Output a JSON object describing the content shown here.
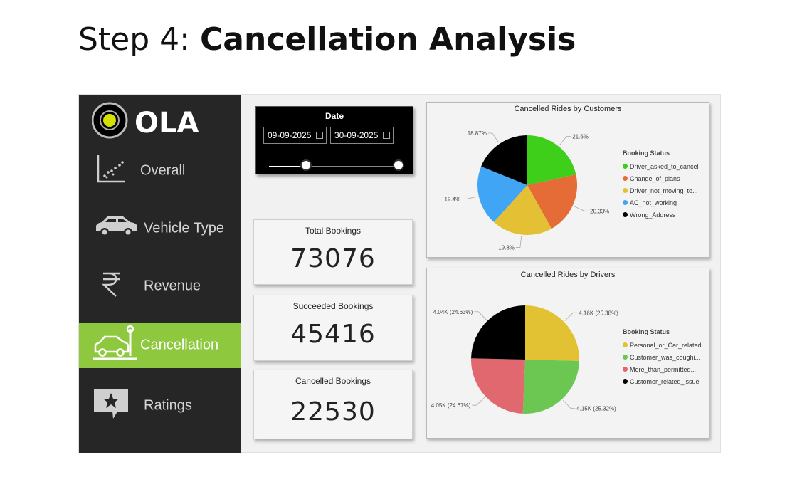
{
  "slide_title": {
    "prefix": "Step 4: ",
    "bold": "Cancellation Analysis"
  },
  "logo": {
    "text": "OLA"
  },
  "sidebar": {
    "items": [
      {
        "label": "Overall",
        "icon": "scatter-chart-icon"
      },
      {
        "label": "Vehicle Type",
        "icon": "car-icon"
      },
      {
        "label": "Revenue",
        "icon": "rupee-icon"
      },
      {
        "label": "Cancellation",
        "icon": "car-crash-icon",
        "active": true
      },
      {
        "label": "Ratings",
        "icon": "star-badge-icon"
      }
    ]
  },
  "date_filter": {
    "title": "Date",
    "start": "09-09-2025",
    "end": "30-09-2025",
    "slider_start": 0.25,
    "slider_end": 1.0
  },
  "kpis": [
    {
      "title": "Total Bookings",
      "value": "73076"
    },
    {
      "title": "Succeeded Bookings",
      "value": "45416"
    },
    {
      "title": "Cancelled Bookings",
      "value": "22530"
    }
  ],
  "colors": {
    "sidebar": "#262626",
    "active": "#8dc83f"
  },
  "chart_data": [
    {
      "type": "pie",
      "title": "Cancelled Rides by Customers",
      "legend_title": "Booking Status",
      "legend": "right",
      "slices": [
        {
          "name": "Driver_asked_to_cancel",
          "value": 21.6,
          "label": "21.6%",
          "color": "#3ecf1a"
        },
        {
          "name": "Change_of_plans",
          "value": 20.33,
          "label": "20.33%",
          "color": "#e66c37"
        },
        {
          "name": "Driver_not_moving_to...",
          "value": 19.8,
          "label": "19.8%",
          "color": "#e3c034"
        },
        {
          "name": "AC_not_working",
          "value": 19.4,
          "label": "19.4%",
          "color": "#41a5f5"
        },
        {
          "name": "Wrong_Address",
          "value": 18.87,
          "label": "18.87%",
          "color": "#000000"
        }
      ]
    },
    {
      "type": "pie",
      "title": "Cancelled Rides by Drivers",
      "legend_title": "Booking Status",
      "legend": "right",
      "slices": [
        {
          "name": "Personal_or_Car_related",
          "value": 25.38,
          "label": "4.16K (25.38%)",
          "color": "#e2c232"
        },
        {
          "name": "Customer_was_coughi...",
          "value": 25.32,
          "label": "4.15K (25.32%)",
          "color": "#6cc752"
        },
        {
          "name": "More_than_permitted...",
          "value": 24.67,
          "label": "4.05K (24.67%)",
          "color": "#e0686e"
        },
        {
          "name": "Customer_related_issue",
          "value": 24.63,
          "label": "4.04K (24.63%)",
          "color": "#000000"
        }
      ]
    }
  ]
}
